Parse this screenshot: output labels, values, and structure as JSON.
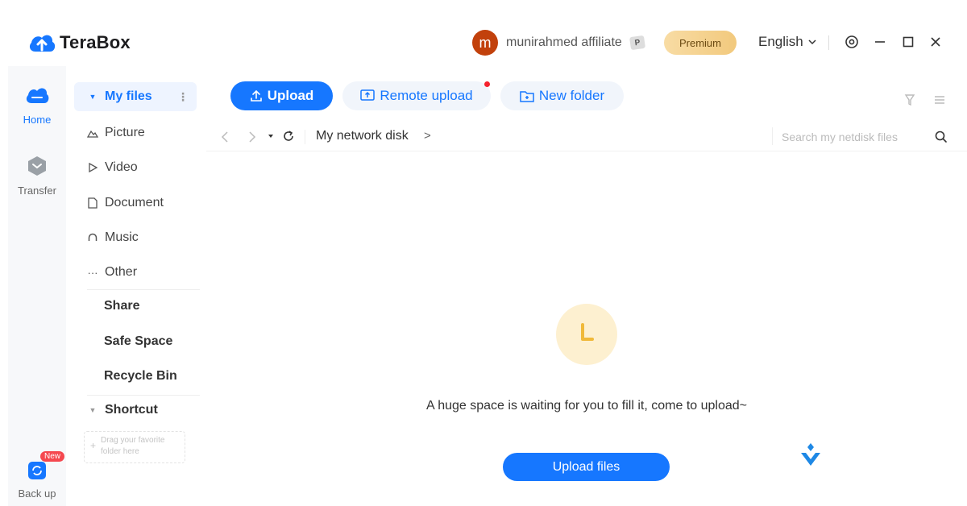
{
  "app": {
    "name": "TeraBox"
  },
  "header": {
    "avatar_initial": "m",
    "username": "munirahmed affiliate",
    "badge": "P",
    "premium_label": "Premium",
    "language": "English"
  },
  "rail": {
    "home_label": "Home",
    "transfer_label": "Transfer",
    "backup_label": "Back up",
    "new_tag": "New"
  },
  "sidebar": {
    "my_files": "My files",
    "items": [
      {
        "label": "Picture",
        "icon": "picture-icon"
      },
      {
        "label": "Video",
        "icon": "video-icon"
      },
      {
        "label": "Document",
        "icon": "document-icon"
      },
      {
        "label": "Music",
        "icon": "music-icon"
      },
      {
        "label": "Other",
        "icon": "other-icon"
      }
    ],
    "share": "Share",
    "safe_space": "Safe Space",
    "recycle_bin": "Recycle Bin",
    "shortcut": "Shortcut",
    "drop_hint_line1": "Drag your favorite",
    "drop_hint_line2": "folder here"
  },
  "toolbar": {
    "upload": "Upload",
    "remote_upload": "Remote upload",
    "new_folder": "New folder"
  },
  "path": {
    "breadcrumb": "My network disk",
    "arrow": ">",
    "search_placeholder": "Search my netdisk files"
  },
  "empty": {
    "message": "A huge space is waiting for you to fill it, come to upload~",
    "button": "Upload files"
  },
  "colors": {
    "accent": "#1677ff",
    "premium": "#f2c97d",
    "avatar": "#c2410c",
    "notice_dot": "#f5222d"
  }
}
